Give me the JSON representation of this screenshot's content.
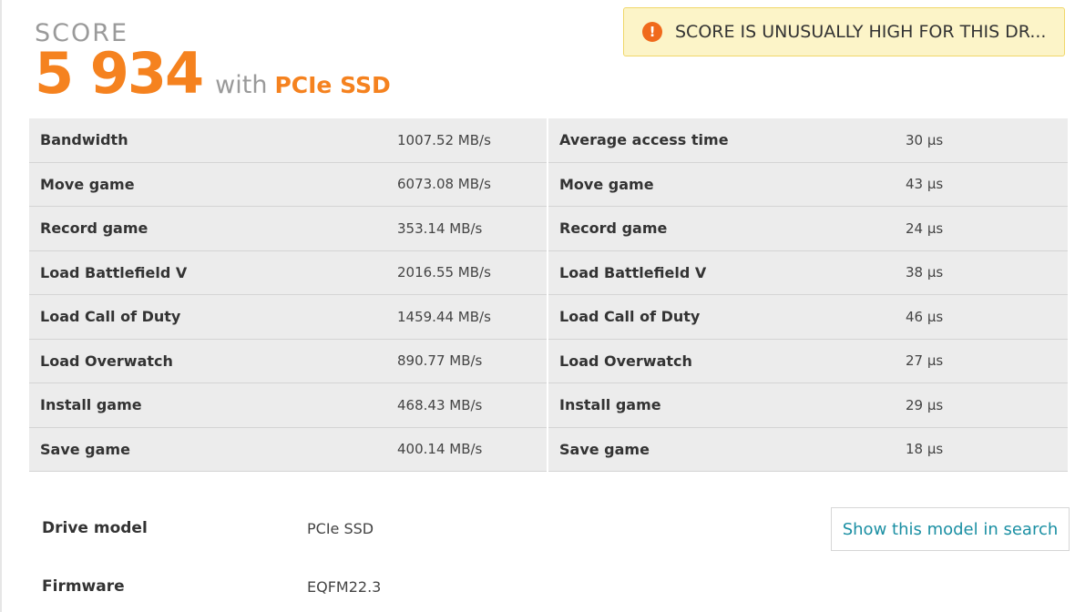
{
  "score": {
    "label": "SCORE",
    "value": "5 934",
    "with_text": "with",
    "drive_name": "PCIe SSD"
  },
  "warning": {
    "icon": "!",
    "text": "SCORE IS UNUSUALLY HIGH FOR THIS DR..."
  },
  "results": {
    "rows": [
      {
        "left_label": "Bandwidth",
        "left_value": "1007.52 MB/s",
        "right_label": "Average access time",
        "right_value": "30 μs"
      },
      {
        "left_label": "Move game",
        "left_value": "6073.08 MB/s",
        "right_label": "Move game",
        "right_value": "43 μs"
      },
      {
        "left_label": "Record game",
        "left_value": "353.14 MB/s",
        "right_label": "Record game",
        "right_value": "24 μs"
      },
      {
        "left_label": "Load Battlefield V",
        "left_value": "2016.55 MB/s",
        "right_label": "Load Battlefield V",
        "right_value": "38 μs"
      },
      {
        "left_label": "Load Call of Duty",
        "left_value": "1459.44 MB/s",
        "right_label": "Load Call of Duty",
        "right_value": "46 μs"
      },
      {
        "left_label": "Load Overwatch",
        "left_value": "890.77 MB/s",
        "right_label": "Load Overwatch",
        "right_value": "27 μs"
      },
      {
        "left_label": "Install game",
        "left_value": "468.43 MB/s",
        "right_label": "Install game",
        "right_value": "29 μs"
      },
      {
        "left_label": "Save game",
        "left_value": "400.14 MB/s",
        "right_label": "Save game",
        "right_value": "18 μs"
      }
    ]
  },
  "details": {
    "drive_model_label": "Drive model",
    "drive_model_value": "PCIe SSD",
    "firmware_label": "Firmware",
    "firmware_value": "EQFM22.3",
    "search_button_label": "Show this model in search"
  },
  "colors": {
    "accent": "#f5821f",
    "link": "#1a8fa3",
    "warning_bg": "#fcf4c8",
    "warning_icon": "#f06a1c",
    "row_bg": "#ececec"
  }
}
